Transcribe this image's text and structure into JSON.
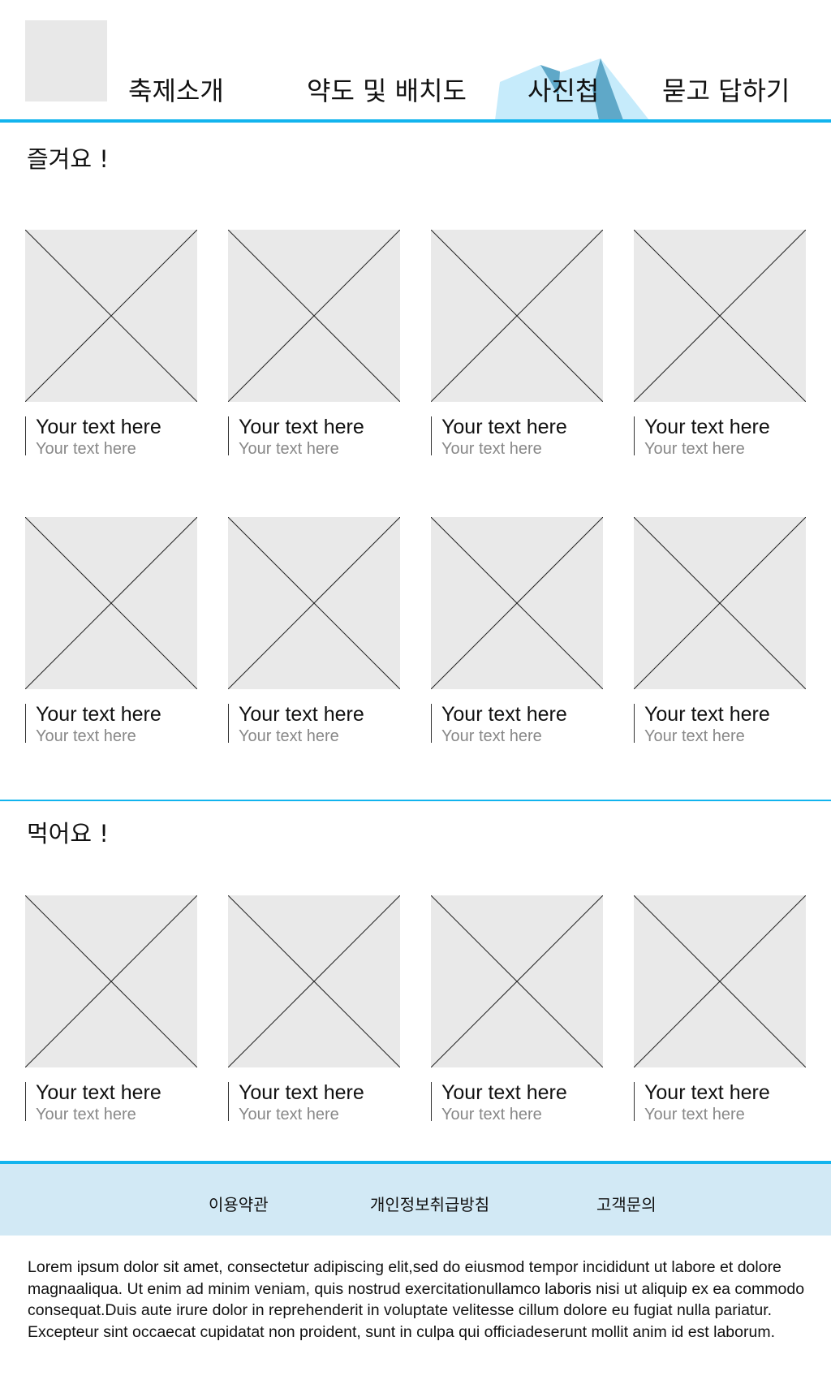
{
  "header": {
    "nav": [
      {
        "label": "축제소개",
        "active": false
      },
      {
        "label": "약도 및 배치도",
        "active": false
      },
      {
        "label": "사진첩",
        "active": true
      },
      {
        "label": "묻고 답하기",
        "active": false
      }
    ]
  },
  "sections": [
    {
      "title": "즐겨요 !",
      "cards": [
        {
          "title": "Your text here",
          "subtitle": "Your text here"
        },
        {
          "title": "Your text here",
          "subtitle": "Your text here"
        },
        {
          "title": "Your text here",
          "subtitle": "Your text here"
        },
        {
          "title": "Your text here",
          "subtitle": "Your text here"
        },
        {
          "title": "Your text here",
          "subtitle": "Your text here"
        },
        {
          "title": "Your text here",
          "subtitle": "Your text here"
        },
        {
          "title": "Your text here",
          "subtitle": "Your text here"
        },
        {
          "title": "Your text here",
          "subtitle": "Your text here"
        }
      ]
    },
    {
      "title": "먹어요 !",
      "cards": [
        {
          "title": "Your text here",
          "subtitle": "Your text here"
        },
        {
          "title": "Your text here",
          "subtitle": "Your text here"
        },
        {
          "title": "Your text here",
          "subtitle": "Your text here"
        },
        {
          "title": "Your text here",
          "subtitle": "Your text here"
        }
      ]
    }
  ],
  "footer": {
    "links": [
      "이용약관",
      "개인정보취급방침",
      "고객문의"
    ],
    "text": "Lorem ipsum dolor sit amet, consectetur adipiscing elit,sed do eiusmod tempor incididunt ut labore et dolore magnaaliqua. Ut enim ad minim veniam, quis nostrud exercitationullamco laboris nisi ut aliquip ex ea commodo consequat.Duis aute irure dolor in reprehenderit in voluptate velitesse cillum dolore eu fugiat nulla pariatur. Excepteur sint occaecat cupidatat non proident, sunt in culpa qui officiadeserunt mollit anim id est laborum."
  },
  "colors": {
    "accent": "#12b4ee",
    "footer_bg": "#d2e9f5",
    "placeholder_bg": "#e9e9e9",
    "deco_light": "#c6ebfb",
    "deco_dark": "#5fa8c8"
  },
  "icons": {
    "logo": "logo-placeholder",
    "thumbnail": "image-placeholder-icon",
    "active_tab": "mountain-shape"
  }
}
